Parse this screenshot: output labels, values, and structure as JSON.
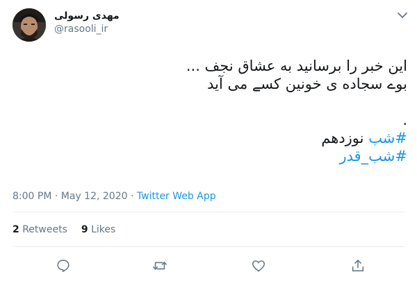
{
  "author": {
    "display_name": "مهدی رسولی",
    "username": "@rasooli_ir"
  },
  "tweet": {
    "lines": [
      "این خبر را برسانید به عشاق نجف ...",
      "بوے سجاده ی خونین کسے می آید"
    ],
    "dot": ".",
    "hashtag1": "#شب",
    "hashtag1_rest": " نوزدهم",
    "hashtag2": "#شب_قدر"
  },
  "meta": {
    "time": "8:00 PM",
    "separator": " · ",
    "date": "May 12, 2020",
    "source": "Twitter Web App"
  },
  "stats": {
    "retweets_count": "2",
    "retweets_label": " Retweets",
    "likes_count": "9",
    "likes_label": " Likes"
  },
  "colors": {
    "link": "#1b95e0",
    "secondary_text": "#657786",
    "icon": "#657786",
    "divider": "#e6ecf0"
  },
  "icons": {
    "reply": "reply-icon",
    "retweet": "retweet-icon",
    "like": "heart-icon",
    "share": "share-icon",
    "caret": "chevron-down-icon"
  }
}
